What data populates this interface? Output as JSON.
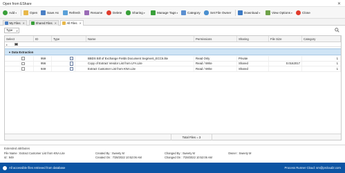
{
  "window": {
    "title": "Open from EShare"
  },
  "toolbar": {
    "add": "Add",
    "open": "Open",
    "save_as": "Save As",
    "refresh": "Refresh",
    "rename": "Rename",
    "delete": "Delete",
    "sharing": "Sharing",
    "manage_tags": "Manage Tags",
    "category": "Category",
    "set_file_owner": "Set File Owner",
    "download": "Download",
    "view_options": "View Options",
    "close": "Close"
  },
  "tabs": [
    {
      "label": "My Files"
    },
    {
      "label": "Shared Files"
    },
    {
      "label": "All Files"
    }
  ],
  "filter": {
    "type_label": "Type"
  },
  "grid": {
    "columns": [
      "Select",
      "ID",
      "Type",
      "Name",
      "Permissions",
      "Sharing",
      "File Size",
      "Category"
    ],
    "group_label": "Data Extraction",
    "rows": [
      {
        "id": "959",
        "name": "BBDS Bill of Exchange Fields Document Segment_ECC6.lite",
        "permissions": "Read Only",
        "sharing": "Private",
        "file_size": "",
        "category": "1"
      },
      {
        "id": "956",
        "name": "Copy of Extract Vendor List from LFA.Lite",
        "permissions": "Read / Write",
        "sharing": "Shared",
        "file_size": "0.0162017",
        "category": "1"
      },
      {
        "id": "949",
        "name": "Extract Customer List from KNA.Lite",
        "permissions": "Read / Write",
        "sharing": "Shared",
        "file_size": "",
        "category": "1"
      }
    ],
    "total": "Total Files = 3"
  },
  "extended": {
    "header": "Extended attributes",
    "file_name": "File Name : Extract Customer List from KNA.Lite",
    "id": "Id : 949",
    "created_by": "Created By : Sweety M",
    "created_on": "Created On : 7/28/2022 10:52:06 AM",
    "changed_by": "Changed By : Sweety M",
    "changed_on": "Changed On : 7/28/2022 10:52:06 AM",
    "owner": "Owner : Sweety M"
  },
  "status": {
    "left": "All accessible files retrieved from database",
    "right": "Process Runner Cloud: sm@prcloud2.com"
  },
  "colors": {
    "accent": "#0c54a3",
    "group_bg": "#cfe4f5",
    "delete_red": "#e03b2c",
    "green": "#3aa03a"
  }
}
